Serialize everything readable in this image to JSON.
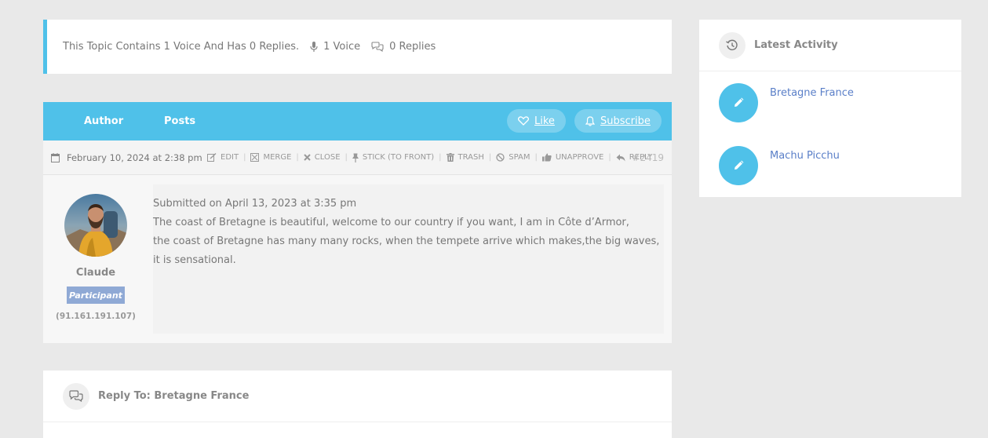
{
  "topic_info": {
    "description": "This Topic Contains 1 Voice And Has 0 Replies.",
    "voices": "1 Voice",
    "replies": "0 Replies"
  },
  "thread_header": {
    "author_label": "Author",
    "posts_label": "Posts",
    "like_label": "Like",
    "subscribe_label": "Subscribe"
  },
  "reply": {
    "date": "February 10, 2024 at 2:38 pm",
    "admin_links": [
      "Edit",
      "Merge",
      "Close",
      "Stick (To Front)",
      "Trash",
      "Spam",
      "Unapprove",
      "Reply"
    ],
    "permalink": "#2419",
    "author": {
      "name": "Claude",
      "role": "Participant",
      "ip": "(91.161.191.107)"
    },
    "content": {
      "submitted": "Submitted on April 13, 2023 at 3:35 pm",
      "line1": "The coast of Bretagne is beautiful, welcome to our country if you want, I am in Côte d’Armor,",
      "line2": "the coast of Bretagne has many many rocks, when the tempete arrive which makes,the big waves, it is sensational."
    }
  },
  "reply_form": {
    "title": "Reply To: Bretagne France"
  },
  "sidebar": {
    "title": "Latest Activity",
    "items": [
      {
        "label": "Bretagne France",
        "icon": "pencil-icon"
      },
      {
        "label": "Machu Picchu",
        "icon": "pencil-icon"
      }
    ]
  },
  "colors": {
    "accent": "#4fc1e9",
    "badge": "#8fa9d5",
    "link": "#5a7fc8",
    "background": "#e9e9e9"
  }
}
